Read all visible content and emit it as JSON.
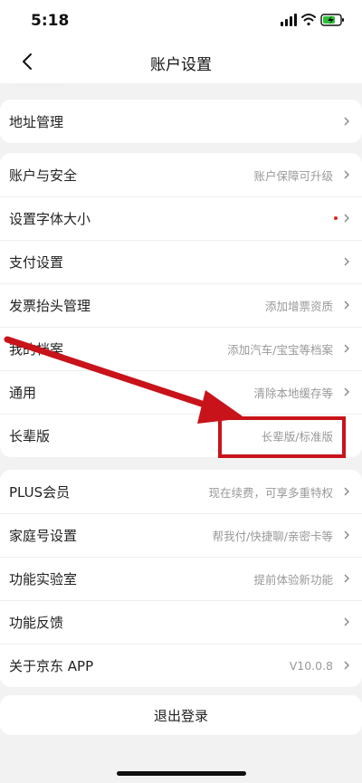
{
  "status_bar": {
    "time": "5:18"
  },
  "nav": {
    "title": "账户设置"
  },
  "groups": [
    {
      "items": [
        {
          "label": "地址管理",
          "value": ""
        }
      ]
    },
    {
      "items": [
        {
          "label": "账户与安全",
          "value": "账户保障可升级"
        },
        {
          "label": "设置字体大小",
          "value": ""
        },
        {
          "label": "支付设置",
          "value": ""
        },
        {
          "label": "发票抬头管理",
          "value": "添加增票资质"
        },
        {
          "label": "我的档案",
          "value": "添加汽车/宝宝等档案"
        },
        {
          "label": "通用",
          "value": "清除本地缓存等"
        },
        {
          "label": "长辈版",
          "value": "长辈版/标准版"
        }
      ]
    },
    {
      "items": [
        {
          "label": "PLUS会员",
          "value": "现在续费，可享多重特权"
        },
        {
          "label": "家庭号设置",
          "value": "帮我付/快捷聊/亲密卡等"
        },
        {
          "label": "功能实验室",
          "value": "提前体验新功能"
        },
        {
          "label": "功能反馈",
          "value": ""
        },
        {
          "label": "关于京东 APP",
          "value": "V10.0.8"
        }
      ]
    }
  ],
  "logout": {
    "label": "退出登录"
  },
  "colors": {
    "annotation": "#c8131a",
    "badge_dot": "#e1251b",
    "page_bg": "#f2f2f2",
    "text_secondary": "#999999"
  },
  "icons": {
    "back": "chevron-left-icon",
    "row_arrow": "chevron-right-icon",
    "badge": "red-dot-badge"
  }
}
